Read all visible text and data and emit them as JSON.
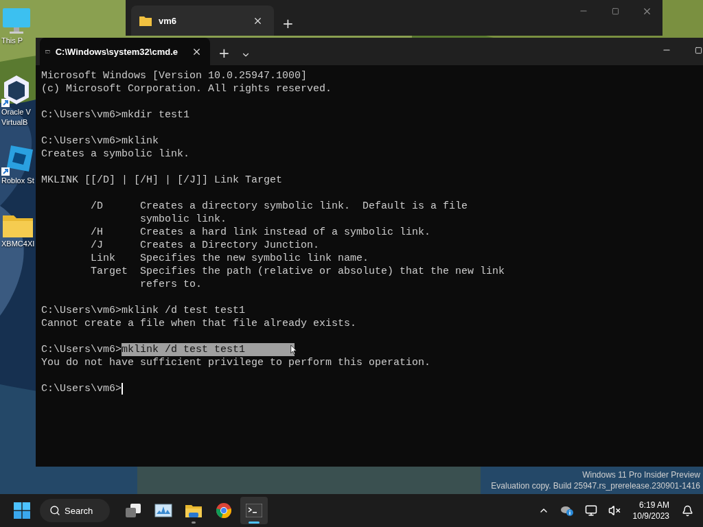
{
  "desktop_icons": [
    {
      "kind": "monitor",
      "label": "This P"
    },
    {
      "kind": "virtualbox",
      "label": "Oracle V\nVirtualB"
    },
    {
      "kind": "roblox",
      "label": "Roblox St"
    },
    {
      "kind": "folder",
      "label": "XBMC4XI"
    }
  ],
  "explorer_window": {
    "tab": "vm6",
    "new_tab": "+"
  },
  "terminal": {
    "tab": "C:\\Windows\\system32\\cmd.e",
    "new_tab": "+",
    "blocks": [
      [
        {
          "text": "Microsoft Windows [Version 10.0.25947.1000]"
        },
        {
          "text": "(c) Microsoft Corporation. All rights reserved."
        }
      ],
      [
        {
          "text": "C:\\Users\\vm6>mkdir test1"
        }
      ],
      [
        {
          "text": "C:\\Users\\vm6>mklink"
        },
        {
          "text": "Creates a symbolic link."
        }
      ],
      [
        {
          "text": "MKLINK [[/D] | [/H] | [/J]] Link Target"
        }
      ],
      [
        {
          "text": "        /D      Creates a directory symbolic link.  Default is a file"
        },
        {
          "text": "                symbolic link."
        },
        {
          "text": "        /H      Creates a hard link instead of a symbolic link."
        },
        {
          "text": "        /J      Creates a Directory Junction."
        },
        {
          "text": "        Link    Specifies the new symbolic link name."
        },
        {
          "text": "        Target  Specifies the path (relative or absolute) that the new link"
        },
        {
          "text": "                refers to."
        }
      ],
      [
        {
          "text": "C:\\Users\\vm6>mklink /d test test1"
        },
        {
          "text": "Cannot create a file when that file already exists."
        }
      ],
      [
        {
          "text": "C:\\Users\\vm6>",
          "selection": "mklink /d test test1"
        },
        {
          "text": "You do not have sufficient privilege to perform this operation."
        }
      ],
      [
        {
          "text": "C:\\Users\\vm6>",
          "cursor": true
        }
      ]
    ]
  },
  "watermark": [
    "Windows 11 Pro Insider Preview",
    "Evaluation copy. Build 25947.rs_prerelease.230901-1416"
  ],
  "taskbar": {
    "search": "Search",
    "apps": [
      {
        "kind": "taskview",
        "running": false,
        "selected": false
      },
      {
        "kind": "monitor",
        "running": false,
        "selected": false
      },
      {
        "kind": "explorer",
        "running": true,
        "selected": false
      },
      {
        "kind": "chrome",
        "running": false,
        "selected": false
      },
      {
        "kind": "terminal",
        "running": true,
        "selected": true
      }
    ],
    "time": "6:19 AM",
    "date": "10/9/2023"
  }
}
